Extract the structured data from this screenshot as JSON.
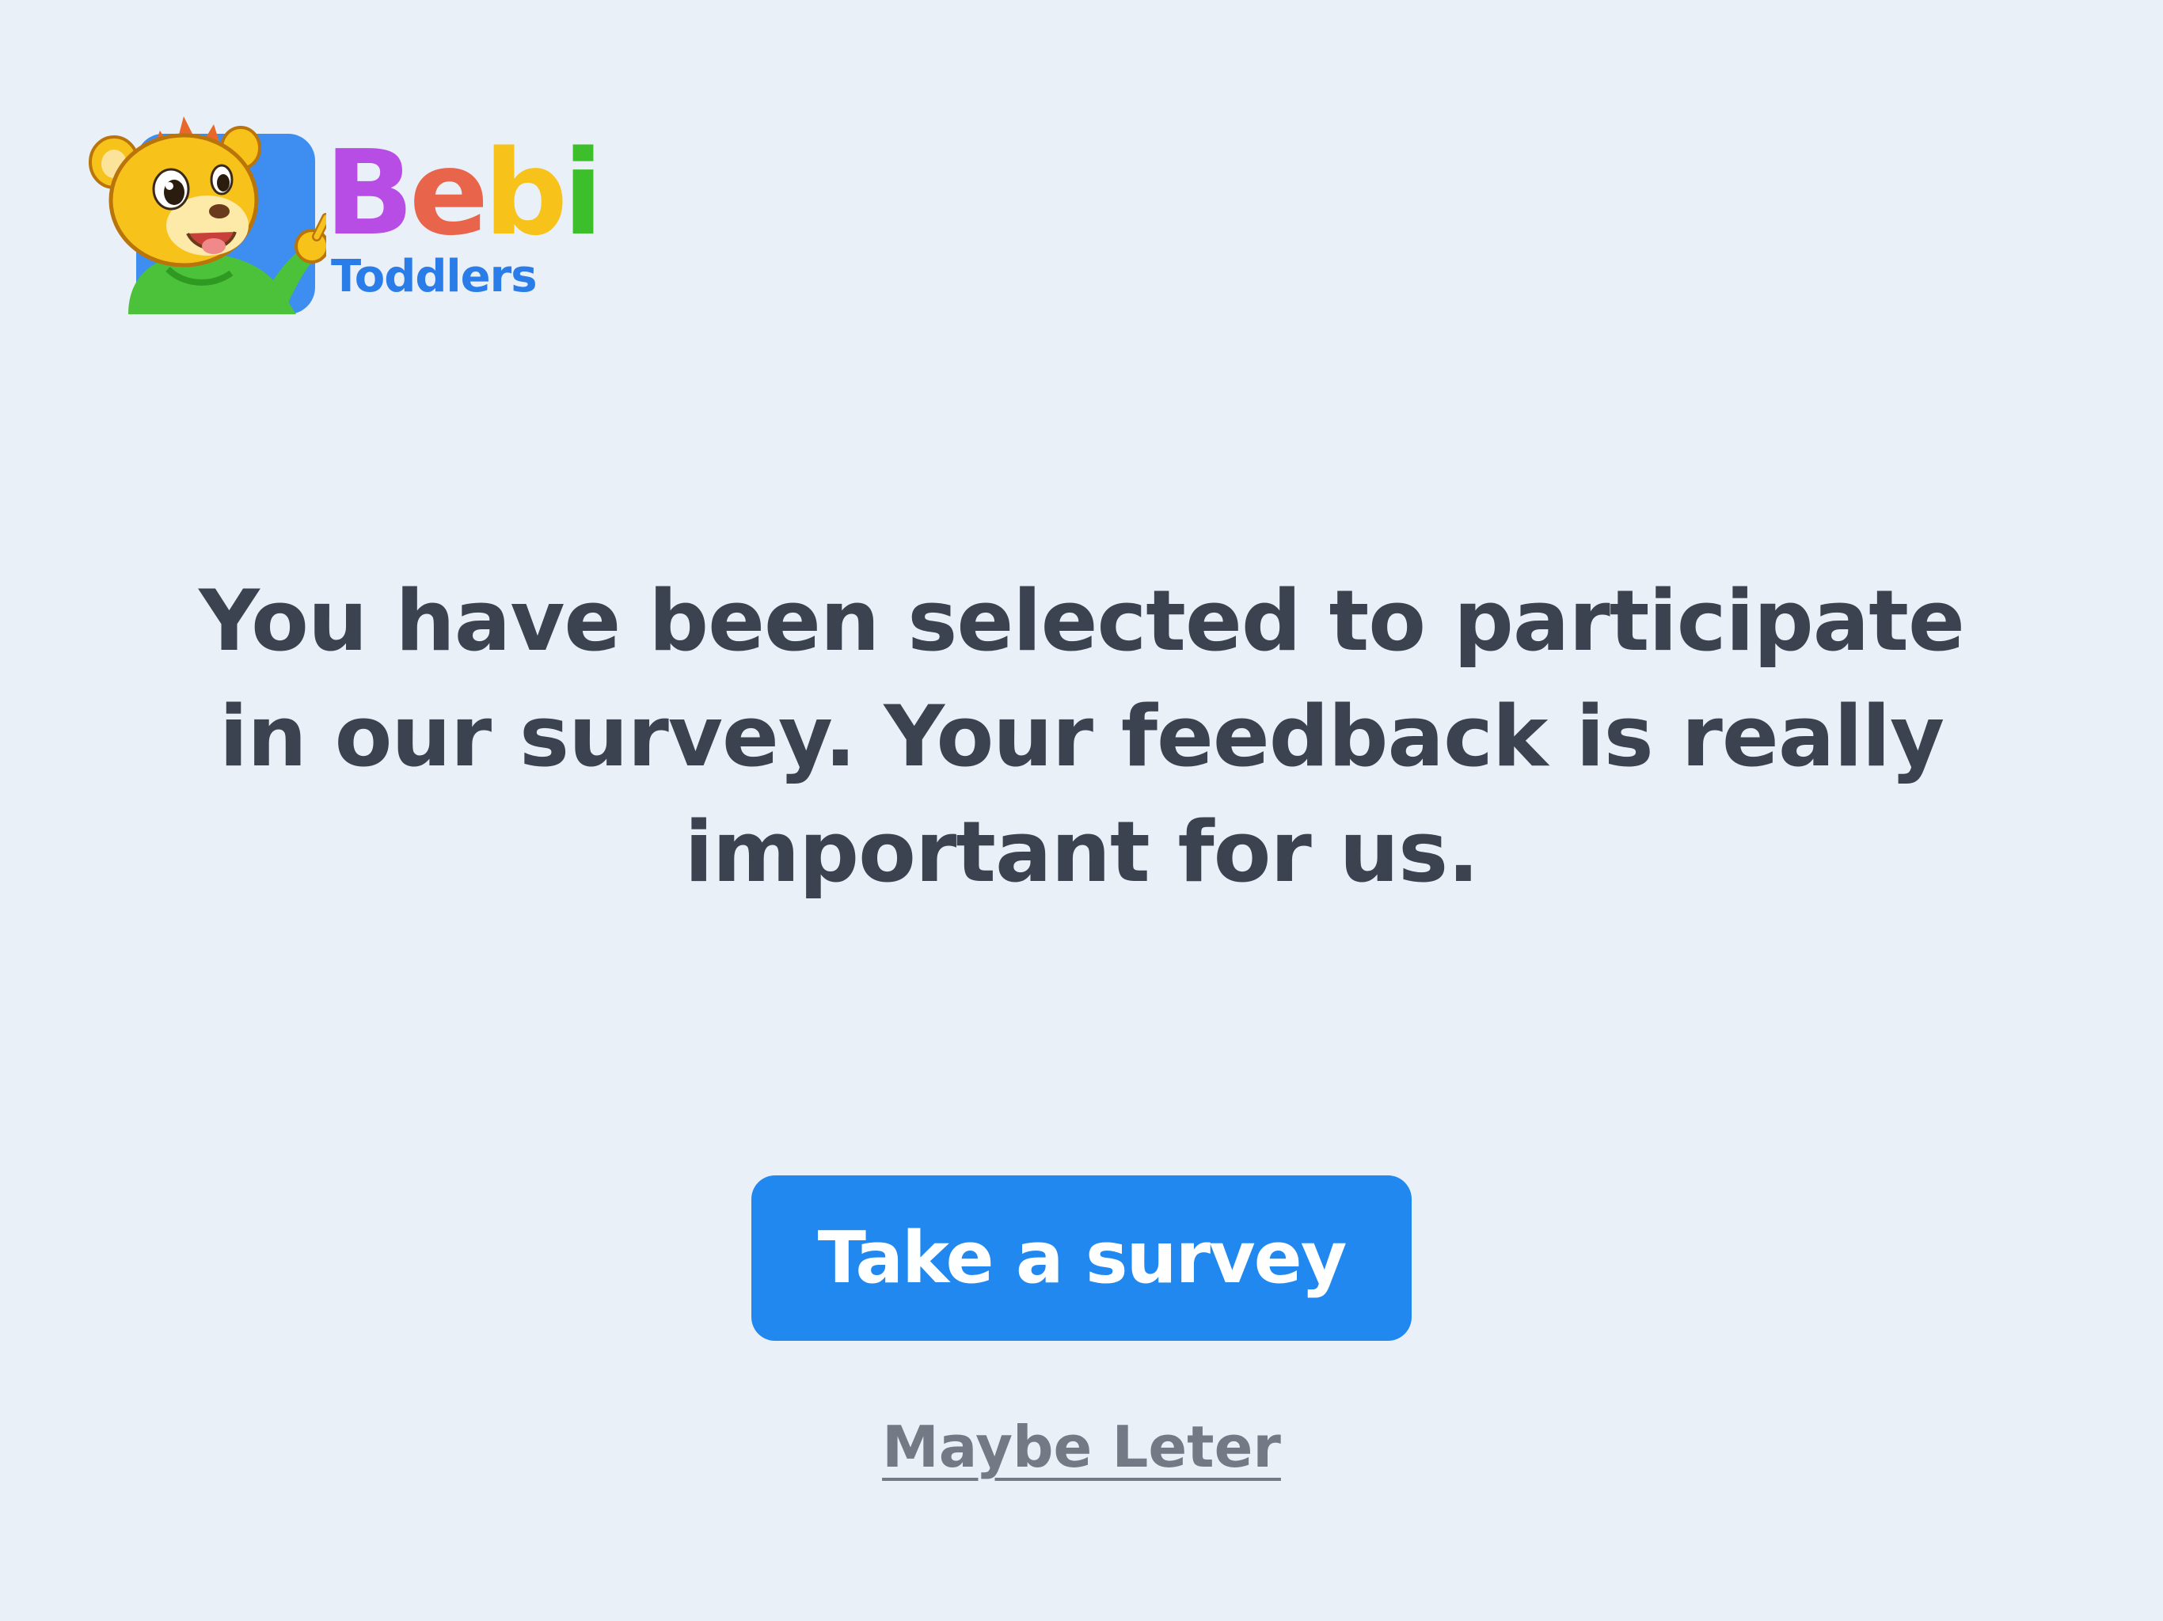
{
  "logo": {
    "word_letters": [
      {
        "char": "B",
        "color": "#b84de6"
      },
      {
        "char": "e",
        "color": "#e8644a"
      },
      {
        "char": "b",
        "color": "#f7c21a"
      },
      {
        "char": "i",
        "color": "#3cbf2a"
      }
    ],
    "subtitle": "Toddlers",
    "mascot_icon": "lion-cub-mascot-icon"
  },
  "message": "You have been selected to participate in our survey. Your feedback is really important for us.",
  "primary_button": {
    "label": "Take a survey",
    "color": "#2188f0"
  },
  "secondary_link": {
    "label": "Maybe Leter"
  },
  "colors": {
    "background": "#e9f0f8",
    "text": "#3b4350",
    "link": "#737a85"
  }
}
